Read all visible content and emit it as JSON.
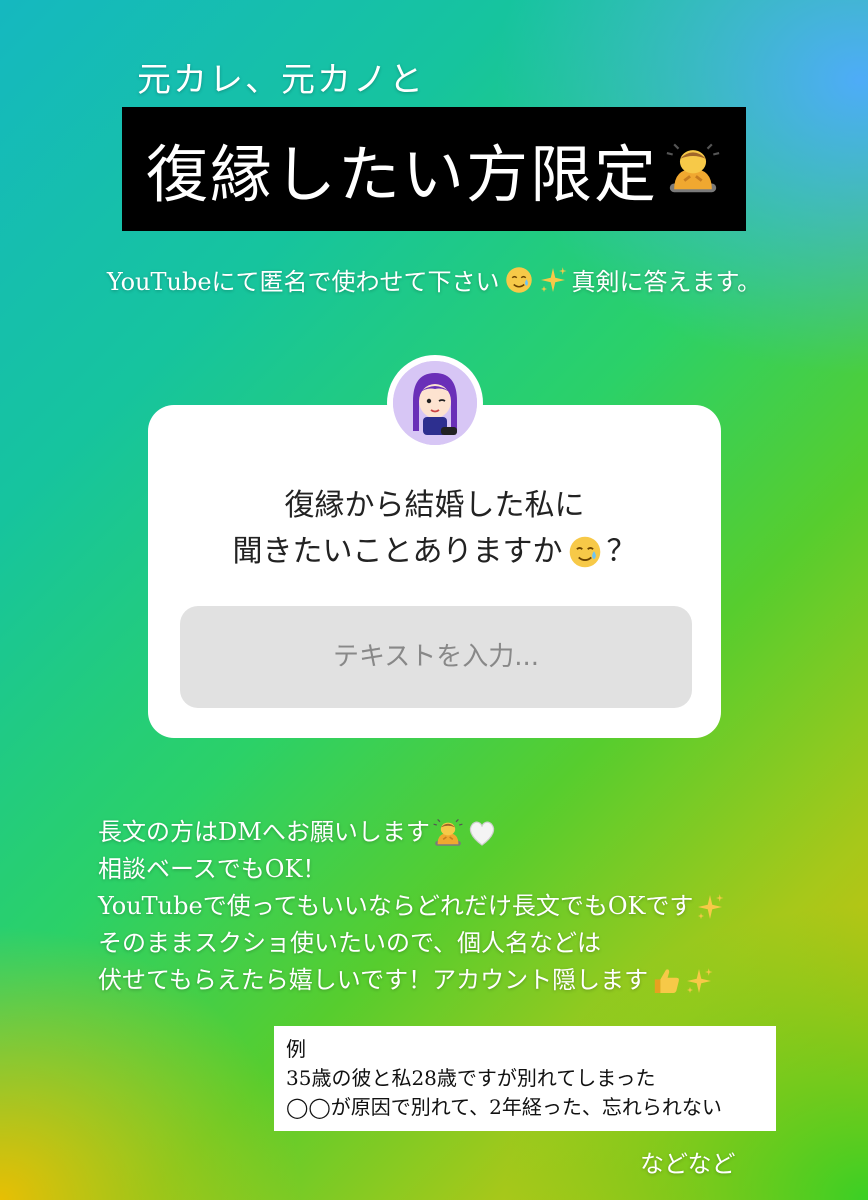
{
  "header": {
    "top_line": "元カレ、元カノと",
    "title": "復縁したい方限定"
  },
  "subtitle": {
    "text_before": "YouTubeにて匿名で使わせて下さい",
    "text_after": "真剣に答えます。"
  },
  "question_sticker": {
    "lines": [
      "復縁から結婚した私に",
      "聞きたいことありますか",
      "？"
    ],
    "placeholder": "テキストを入力..."
  },
  "notes": {
    "lines": [
      "長文の方はDMへお願いします",
      "相談ベースでもOK！",
      "YouTubeで使ってもいいならどれだけ長文でもOKです",
      "そのままスクショ使いたいので、個人名などは",
      "伏せてもらえたら嬉しいです！アカウント隠します"
    ]
  },
  "example": {
    "label": "例",
    "line1": "35歳の彼と私28歳ですが別れてしまった",
    "line2": "◯◯が原因で別れて、2年経った、忘れられない"
  },
  "footer": {
    "etc": "などなど"
  },
  "icons": {
    "bow": "person-bowing-icon",
    "teary_smile": "smiling-face-with-tear-icon",
    "sparkles": "sparkles-icon",
    "heart": "white-heart-icon",
    "thumbs": "thumbs-up-icon"
  },
  "colors": {
    "title_bg": "#000000",
    "card_bg": "#ffffff",
    "field_bg": "#e1e1e1"
  }
}
